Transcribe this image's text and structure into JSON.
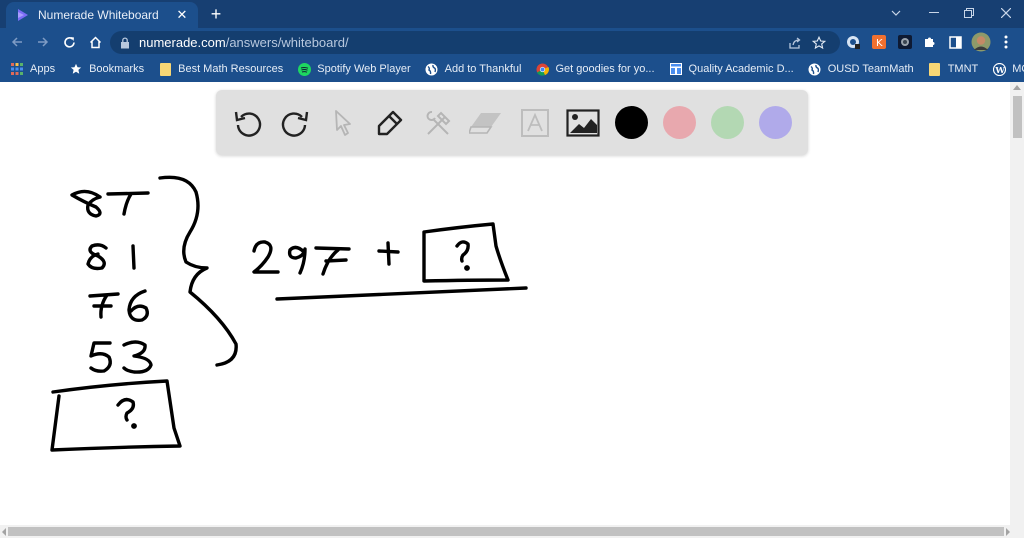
{
  "browser": {
    "tab": {
      "title": "Numerade Whiteboard",
      "favicon": "numerade-logo-icon",
      "close_glyph": "✕"
    },
    "new_tab_glyph": "+",
    "window_controls": [
      "chevron-down-icon",
      "minimize-icon",
      "restore-icon",
      "close-icon"
    ],
    "url": {
      "host": "numerade.com",
      "path": "/answers/whiteboard/"
    },
    "nav": [
      "back-icon",
      "forward-icon",
      "reload-icon",
      "home-icon"
    ],
    "omnibox_icons": [
      "share-icon",
      "star-icon"
    ],
    "extensions": [
      "extension-1-icon",
      "extension-2-icon",
      "extension-3-icon",
      "puzzle-icon",
      "sidepanel-icon",
      "profile-avatar",
      "menu-icon"
    ],
    "bookmarks": [
      {
        "label": "Apps",
        "icon": "apps-grid-icon"
      },
      {
        "label": "Bookmarks",
        "icon": "star-icon"
      },
      {
        "label": "Best Math Resources",
        "icon": "folder-icon"
      },
      {
        "label": "Spotify Web Player",
        "icon": "spotify-icon"
      },
      {
        "label": "Add to Thankful",
        "icon": "globe-icon"
      },
      {
        "label": "Get goodies for yo...",
        "icon": "chrome-icon"
      },
      {
        "label": "Quality Academic D...",
        "icon": "doc-icon"
      },
      {
        "label": "OUSD TeamMath",
        "icon": "globe-icon"
      },
      {
        "label": "TMNT",
        "icon": "folder-icon"
      },
      {
        "label": "MOC - NBPTS",
        "icon": "wordpress-icon"
      }
    ]
  },
  "whiteboard": {
    "tools": [
      {
        "name": "undo",
        "enabled": true
      },
      {
        "name": "redo",
        "enabled": true
      },
      {
        "name": "select",
        "enabled": false
      },
      {
        "name": "pen",
        "enabled": true
      },
      {
        "name": "tools",
        "enabled": false
      },
      {
        "name": "eraser",
        "enabled": false
      },
      {
        "name": "text",
        "enabled": false
      },
      {
        "name": "image",
        "enabled": true
      }
    ],
    "colors": [
      "#000000",
      "#e8a8ae",
      "#b3d8b3",
      "#b0aaea"
    ],
    "handwriting": {
      "column_numbers": [
        "87",
        "81",
        "76",
        "53"
      ],
      "column_box_label": "?",
      "sum_expression": "297 +",
      "sum_box_label": "?"
    }
  }
}
